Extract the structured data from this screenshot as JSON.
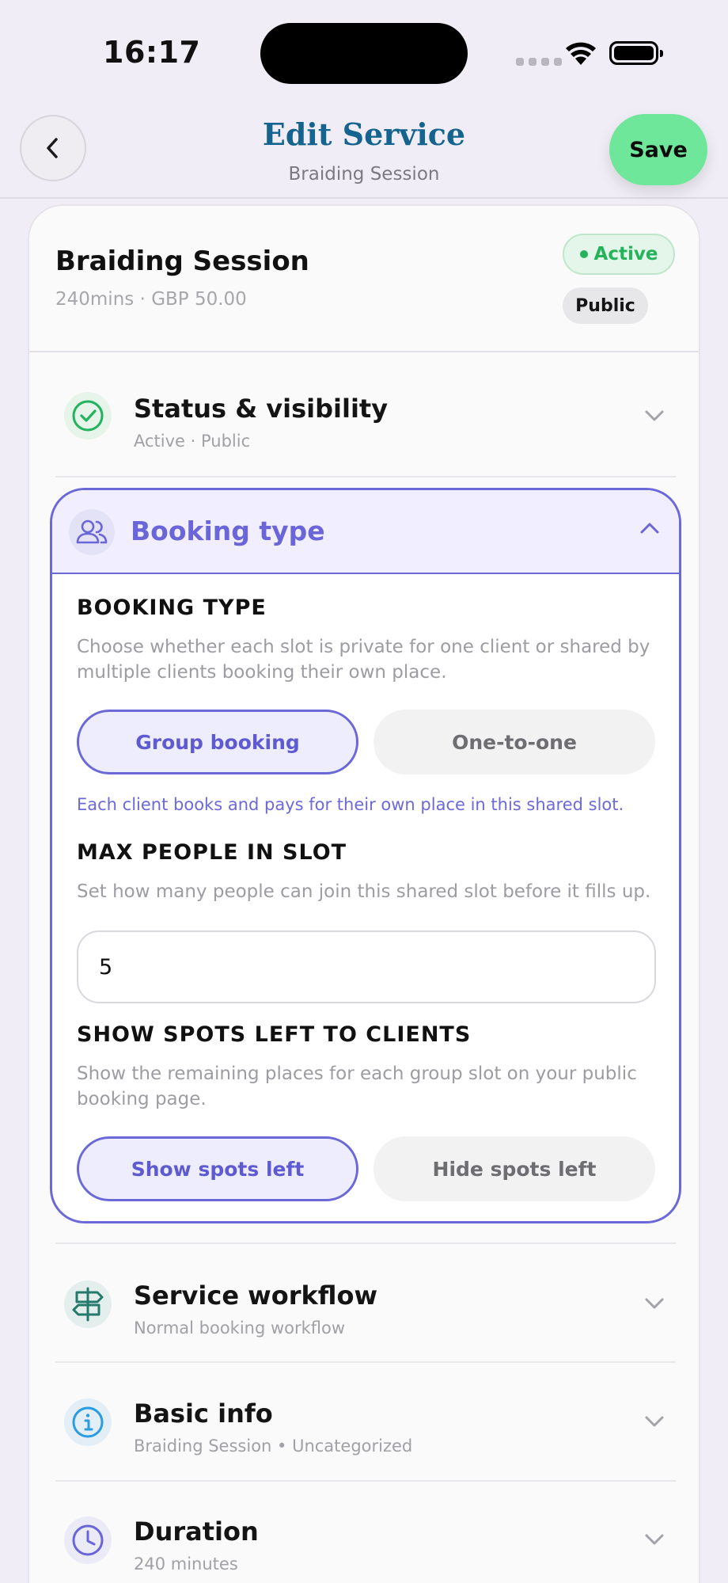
{
  "status_bar": {
    "time": "16:17"
  },
  "header": {
    "title": "Edit Service",
    "subtitle": "Braiding Session",
    "save_label": "Save"
  },
  "service": {
    "name": "Braiding Session",
    "meta": "240mins · GBP 50.00",
    "status_badge": "Active",
    "visibility_badge": "Public",
    "colors": {
      "active": "#24b35a",
      "accent": "#6b68d8",
      "save": "#6ee79a",
      "title": "#14648f"
    }
  },
  "sections": {
    "status": {
      "title": "Status & visibility",
      "subtitle": "Active · Public",
      "icon": "check-circle-icon"
    },
    "booking_type": {
      "title": "Booking type",
      "icon": "users-icon",
      "type_label": "BOOKING TYPE",
      "type_desc": "Choose whether each slot is private for one client or shared by multiple clients booking their own place.",
      "options": [
        "Group booking",
        "One-to-one"
      ],
      "selected": "Group booking",
      "hint": "Each client books and pays for their own place in this shared slot.",
      "max_label": "MAX PEOPLE IN SLOT",
      "max_desc": "Set how many people can join this shared slot before it fills up.",
      "max_value": "5",
      "spots_label": "SHOW SPOTS LEFT TO CLIENTS",
      "spots_desc": "Show the remaining places for each group slot on your public booking page.",
      "spots_options": [
        "Show spots left",
        "Hide spots left"
      ],
      "spots_selected": "Show spots left"
    },
    "workflow": {
      "title": "Service workflow",
      "subtitle": "Normal booking workflow",
      "icon": "signpost-icon"
    },
    "basic_info": {
      "title": "Basic info",
      "subtitle": "Braiding Session • Uncategorized",
      "icon": "info-icon"
    },
    "duration": {
      "title": "Duration",
      "subtitle": "240 minutes",
      "icon": "clock-icon"
    }
  }
}
